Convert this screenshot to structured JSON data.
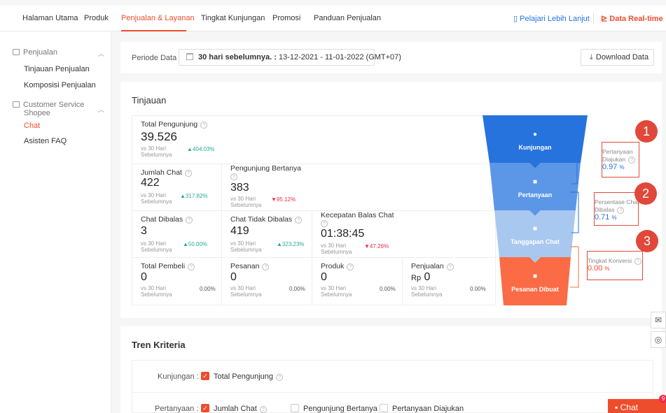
{
  "nav": {
    "items": [
      "Halaman Utama",
      "Produk",
      "Penjualan & Layanan",
      "Tingkat Kunjungan",
      "Promosi",
      "Panduan Penjualan"
    ],
    "learn_more": "Pelajari Lebih Lanjut",
    "realtime": "Data Real-time"
  },
  "sidebar": {
    "penjualan": "Penjualan",
    "tinjauan": "Tinjauan Penjualan",
    "komposisi": "Komposisi Penjualan",
    "cs_line1": "Customer Service",
    "cs_line2": "Shopee",
    "chat": "Chat",
    "faq": "Asisten FAQ"
  },
  "period": {
    "label": "Periode Data",
    "range_bold": "30 hari sebelumnya. :",
    "range": "13-12-2021 - 11-01-2022 (GMT+07)",
    "download": "Download Data"
  },
  "overview": {
    "title": "Tinjauan",
    "vs_label": "vs 30 Hari Sebelumnya",
    "total_pengunjung": {
      "label": "Total Pengunjung",
      "value": "39.526",
      "change": "▲404.03%"
    },
    "jumlah_chat": {
      "label": "Jumlah Chat",
      "value": "422",
      "change": "▲317.82%"
    },
    "pengunjung_bertanya": {
      "label": "Pengunjung Bertanya",
      "value": "383",
      "change": "▼95.12%"
    },
    "chat_dibalas": {
      "label": "Chat Dibalas",
      "value": "3",
      "change": "▲50.00%"
    },
    "chat_tidak_dibalas": {
      "label": "Chat Tidak Dibalas",
      "value": "419",
      "change": "▲323.23%"
    },
    "kecepatan": {
      "label": "Kecepatan Balas Chat",
      "value": "01:38:45",
      "change": "▼47.26%"
    },
    "total_pembeli": {
      "label": "Total Pembeli",
      "value": "0",
      "change": "0.00%"
    },
    "pesanan": {
      "label": "Pesanan",
      "value": "0",
      "change": "0.00%"
    },
    "produk": {
      "label": "Produk",
      "value": "0",
      "change": "0.00%"
    },
    "penjualan": {
      "label": "Penjualan",
      "currency": "Rp",
      "value": "0",
      "change": "0.00%"
    }
  },
  "funnel": {
    "stages": [
      "Kunjungan",
      "Pertanyaan",
      "Tanggapan Chat",
      "Pesanan Dibuat"
    ],
    "colors": [
      "#2673dd",
      "#5b97e6",
      "#a9c8f0",
      "#fb6b45"
    ]
  },
  "annotations": {
    "pertanyaan_line1": "Pertanyaan",
    "pertanyaan_line2": "Diajukan",
    "pertanyaan_value": "0.97",
    "persentase_line1": "Persentase Chat",
    "persentase_line2": "Dibalas",
    "persentase_value": "0.71",
    "konversi_label": "Tingkat Konversi",
    "konversi_value": "0.00",
    "unit": "%",
    "badges": [
      "1",
      "2",
      "3"
    ]
  },
  "trend": {
    "title": "Tren Kriteria",
    "kunjungan_label": "Kunjungan :",
    "total_pengunjung": "Total Pengunjung",
    "pertanyaan_label": "Pertanyaan :",
    "jumlah_chat": "Jumlah Chat",
    "pengunjung_bertanya": "Pengunjung Bertanya",
    "pertanyaan_diajukan": "Pertanyaan Diajukan"
  },
  "chat_button": "Chat",
  "chat_badge": "9"
}
